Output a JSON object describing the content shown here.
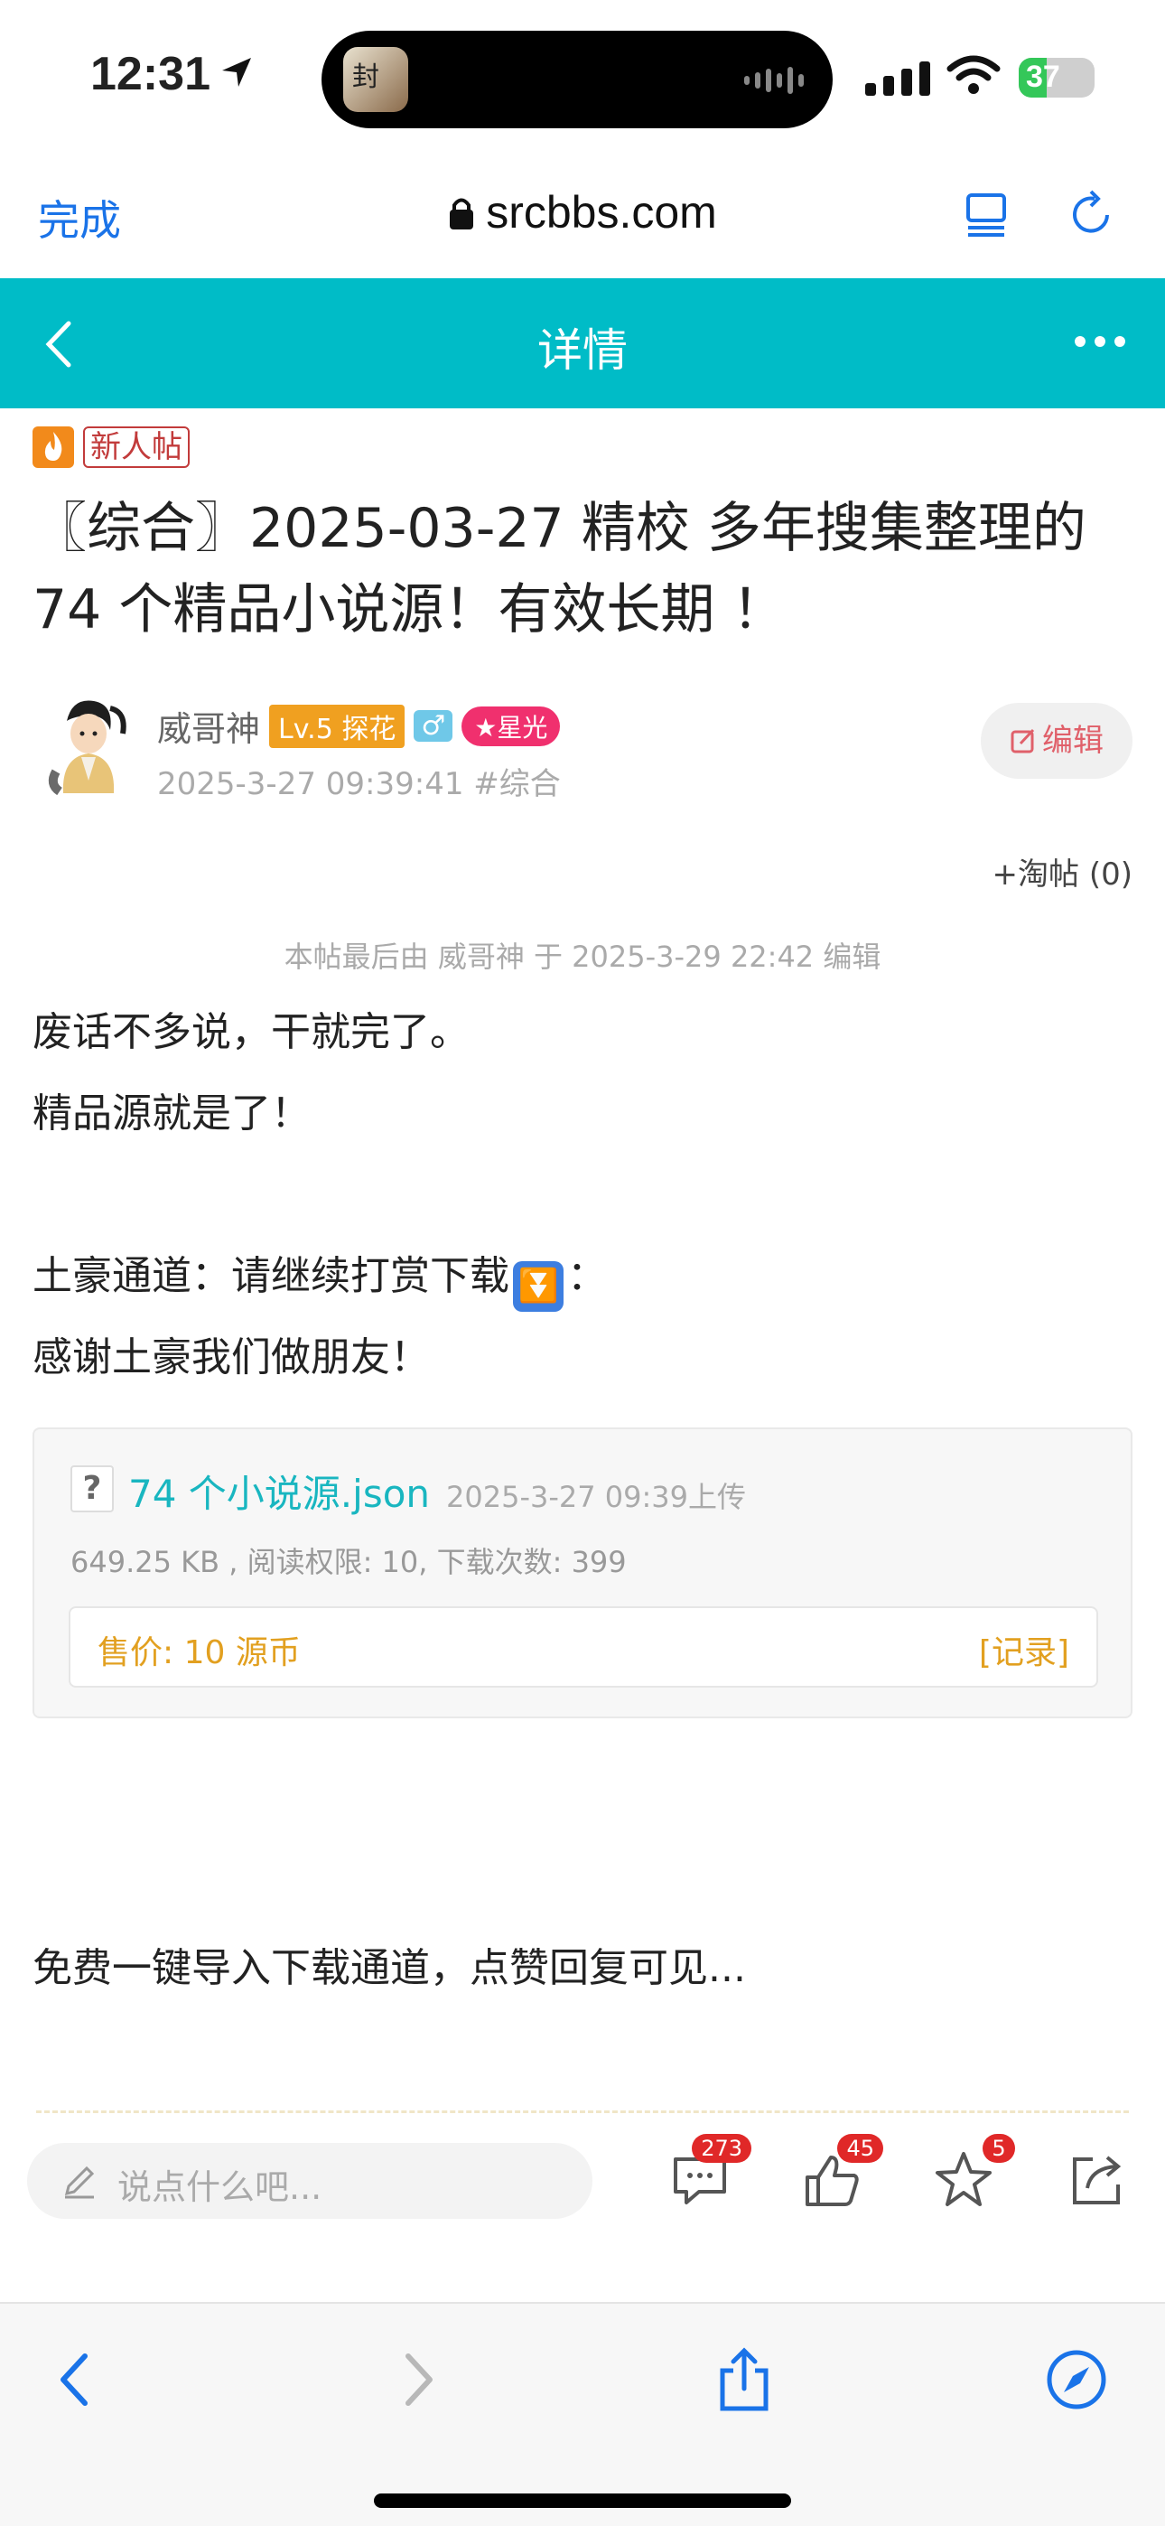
{
  "status_bar": {
    "time": "12:31",
    "battery": "37",
    "battery_level": 0.37
  },
  "browser": {
    "done_label": "完成",
    "url": "srcbbs.com"
  },
  "nav": {
    "title": "详情"
  },
  "tags": {
    "new_post": "新人帖"
  },
  "post": {
    "title": "〖综合〗2025-03-27 精校 多年搜集整理的 74 个精品小说源！有效长期 ！",
    "author": "威哥神",
    "level": "Lv.5 探花",
    "gender": "♂",
    "star_badge": "★星光",
    "meta": "2025-3-27 09:39:41 #综合",
    "edit_label": "编辑",
    "tao_label": "+淘帖 (0)",
    "edited_note": "本帖最后由 威哥神 于 2025-3-29 22:42 编辑",
    "lines": [
      "废话不多说，干就完了。",
      "精品源就是了！",
      "土豪通道：请继续打赏下载",
      "：",
      "感谢土豪我们做朋友！"
    ],
    "footer_text": "免费一键导入下载通道，点赞回复可见..."
  },
  "attachment": {
    "file_name": "74 个小说源.json",
    "upload_time": "2025-3-27 09:39上传",
    "info": "649.25 KB , 阅读权限: 10, 下载次数: 399",
    "price": "售价: 10 源币",
    "record": "[记录]"
  },
  "action_bar": {
    "placeholder": "说点什么吧...",
    "comments": "273",
    "likes": "45",
    "favorites": "5"
  },
  "colors": {
    "accent": "#00bcc7",
    "link": "#1a73e8",
    "badge": "#e02828"
  }
}
